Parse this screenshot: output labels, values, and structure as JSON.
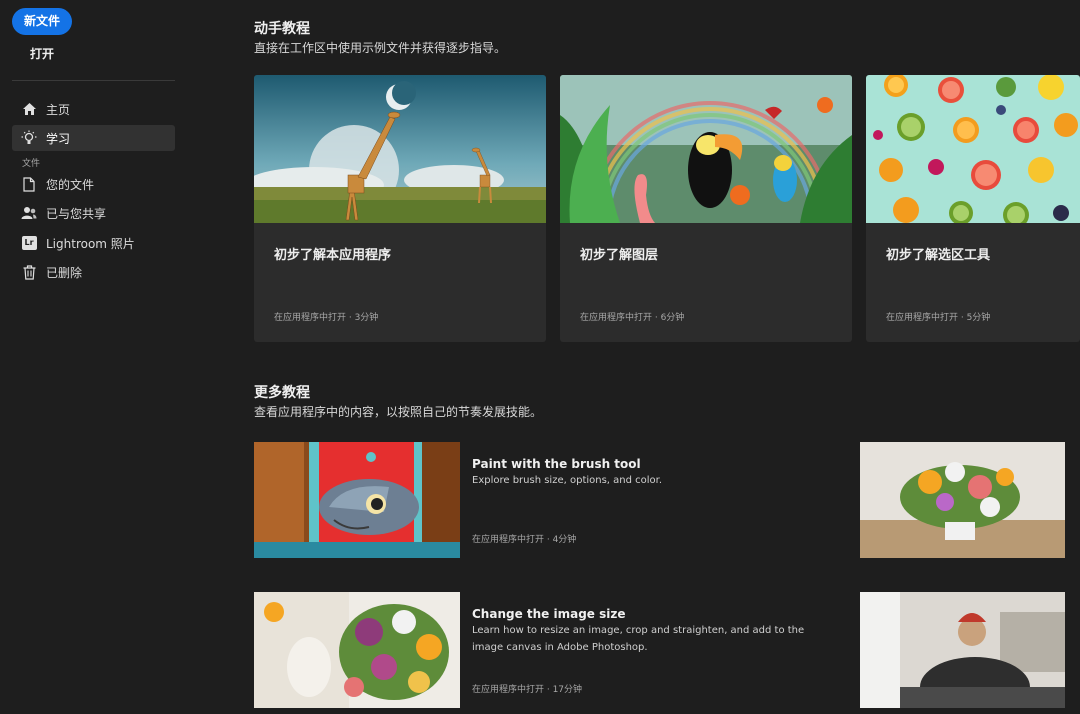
{
  "sidebar": {
    "new_file": "新文件",
    "open": "打开",
    "items": [
      {
        "label": "主页",
        "icon": "home-icon"
      },
      {
        "label": "学习",
        "icon": "lightbulb-icon"
      },
      {
        "label": "您的文件",
        "icon": "file-icon"
      },
      {
        "label": "已与您共享",
        "icon": "people-icon"
      },
      {
        "label": "Lightroom 照片",
        "icon": "lightroom-icon"
      },
      {
        "label": "已删除",
        "icon": "trash-icon"
      }
    ],
    "section_files": "文件",
    "lightroom_badge": "Lr"
  },
  "hands_on": {
    "title": "动手教程",
    "subtitle": "直接在工作区中使用示例文件并获得逐步指导。",
    "cards": [
      {
        "title": "初步了解本应用程序",
        "meta": "在应用程序中打开 · 3分钟"
      },
      {
        "title": "初步了解图层",
        "meta": "在应用程序中打开 · 6分钟"
      },
      {
        "title": "初步了解选区工具",
        "meta": "在应用程序中打开 · 5分钟"
      }
    ]
  },
  "more": {
    "title": "更多教程",
    "subtitle": "查看应用程序中的内容，以按照自己的节奏发展技能。",
    "items": [
      {
        "title": "Paint with the brush tool",
        "desc": "Explore brush size, options, and color.",
        "meta": "在应用程序中打开 · 4分钟"
      },
      {
        "title": "Change the image size",
        "desc": "Learn how to resize an image, crop and straighten, and add to the image canvas in Adobe Photoshop.",
        "meta": "在应用程序中打开 · 17分钟"
      }
    ]
  },
  "colors": {
    "accent": "#1473e6",
    "background": "#1e1e1e",
    "card": "#2c2c2c"
  }
}
